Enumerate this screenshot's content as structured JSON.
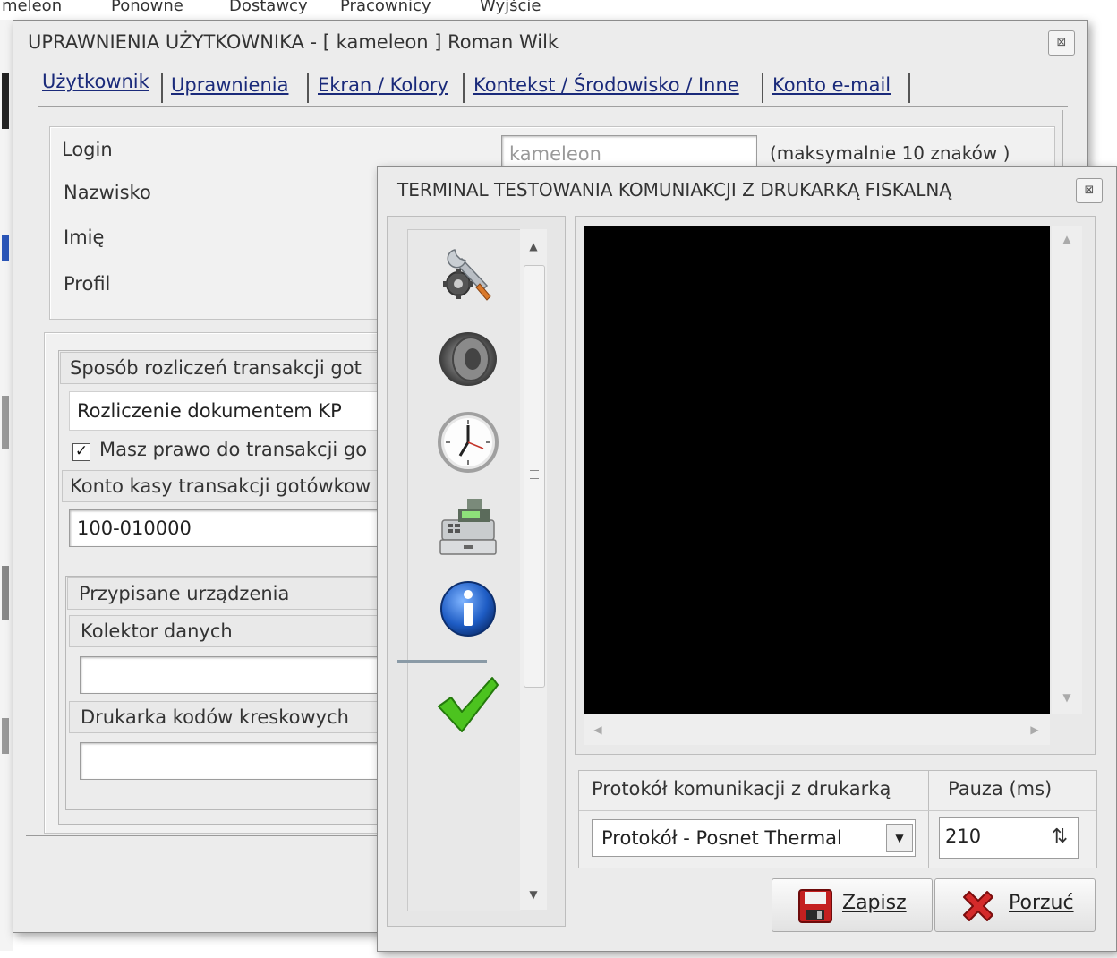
{
  "background": {
    "menu_items": [
      "meleon",
      "Ponowne",
      "Dostawcy",
      "Pracownicy",
      "Wyjście"
    ]
  },
  "user_window": {
    "title": "UPRAWNIENIA UŻYTKOWNIKA - [ kameleon ] Roman Wilk",
    "close_glyph": "⊠",
    "tabs": [
      {
        "label": "Użytkownik"
      },
      {
        "label": "Uprawnienia"
      },
      {
        "label": "Ekran / Kolory"
      },
      {
        "label": "Kontekst / Środowisko / Inne"
      },
      {
        "label": "Konto e-mail"
      }
    ],
    "fields": {
      "login_label": "Login",
      "login_value": "kameleon",
      "login_hint": "(maksymalnie 10 znaków )",
      "surname_label": "Nazwisko",
      "firstname_label": "Imię",
      "profile_label": "Profil"
    },
    "cash": {
      "group_label": "Sposób rozliczeń transakcji got",
      "method_value": "Rozliczenie dokumentem KP",
      "checkbox_label": "Masz prawo do transakcji go",
      "checkbox_checked": true,
      "account_label": "Konto kasy transakcji gotówkow",
      "account_value": "100-010000"
    },
    "devices": {
      "group_label": "Przypisane urządzenia",
      "collector_label": "Kolektor danych",
      "collector_value": "",
      "barcode_label": "Drukarka kodów kreskowych",
      "barcode_value": ""
    }
  },
  "terminal_window": {
    "title": "TERMINAL TESTOWANIA KOMUNIAKCJI Z DRUKARKĄ FISKALNĄ",
    "close_glyph": "⊠",
    "sidebar_icons": [
      "wrench-gear-icon",
      "speaker-icon",
      "clock-icon",
      "cash-register-icon",
      "info-icon",
      "checkmark-icon"
    ],
    "protocol_label": "Protokół komunikacji  z drukarką",
    "protocol_value": "Protokół - Posnet Thermal",
    "pause_label": "Pauza (ms)",
    "pause_value": "210",
    "save_button": "Zapisz",
    "cancel_button": "Porzuć"
  }
}
